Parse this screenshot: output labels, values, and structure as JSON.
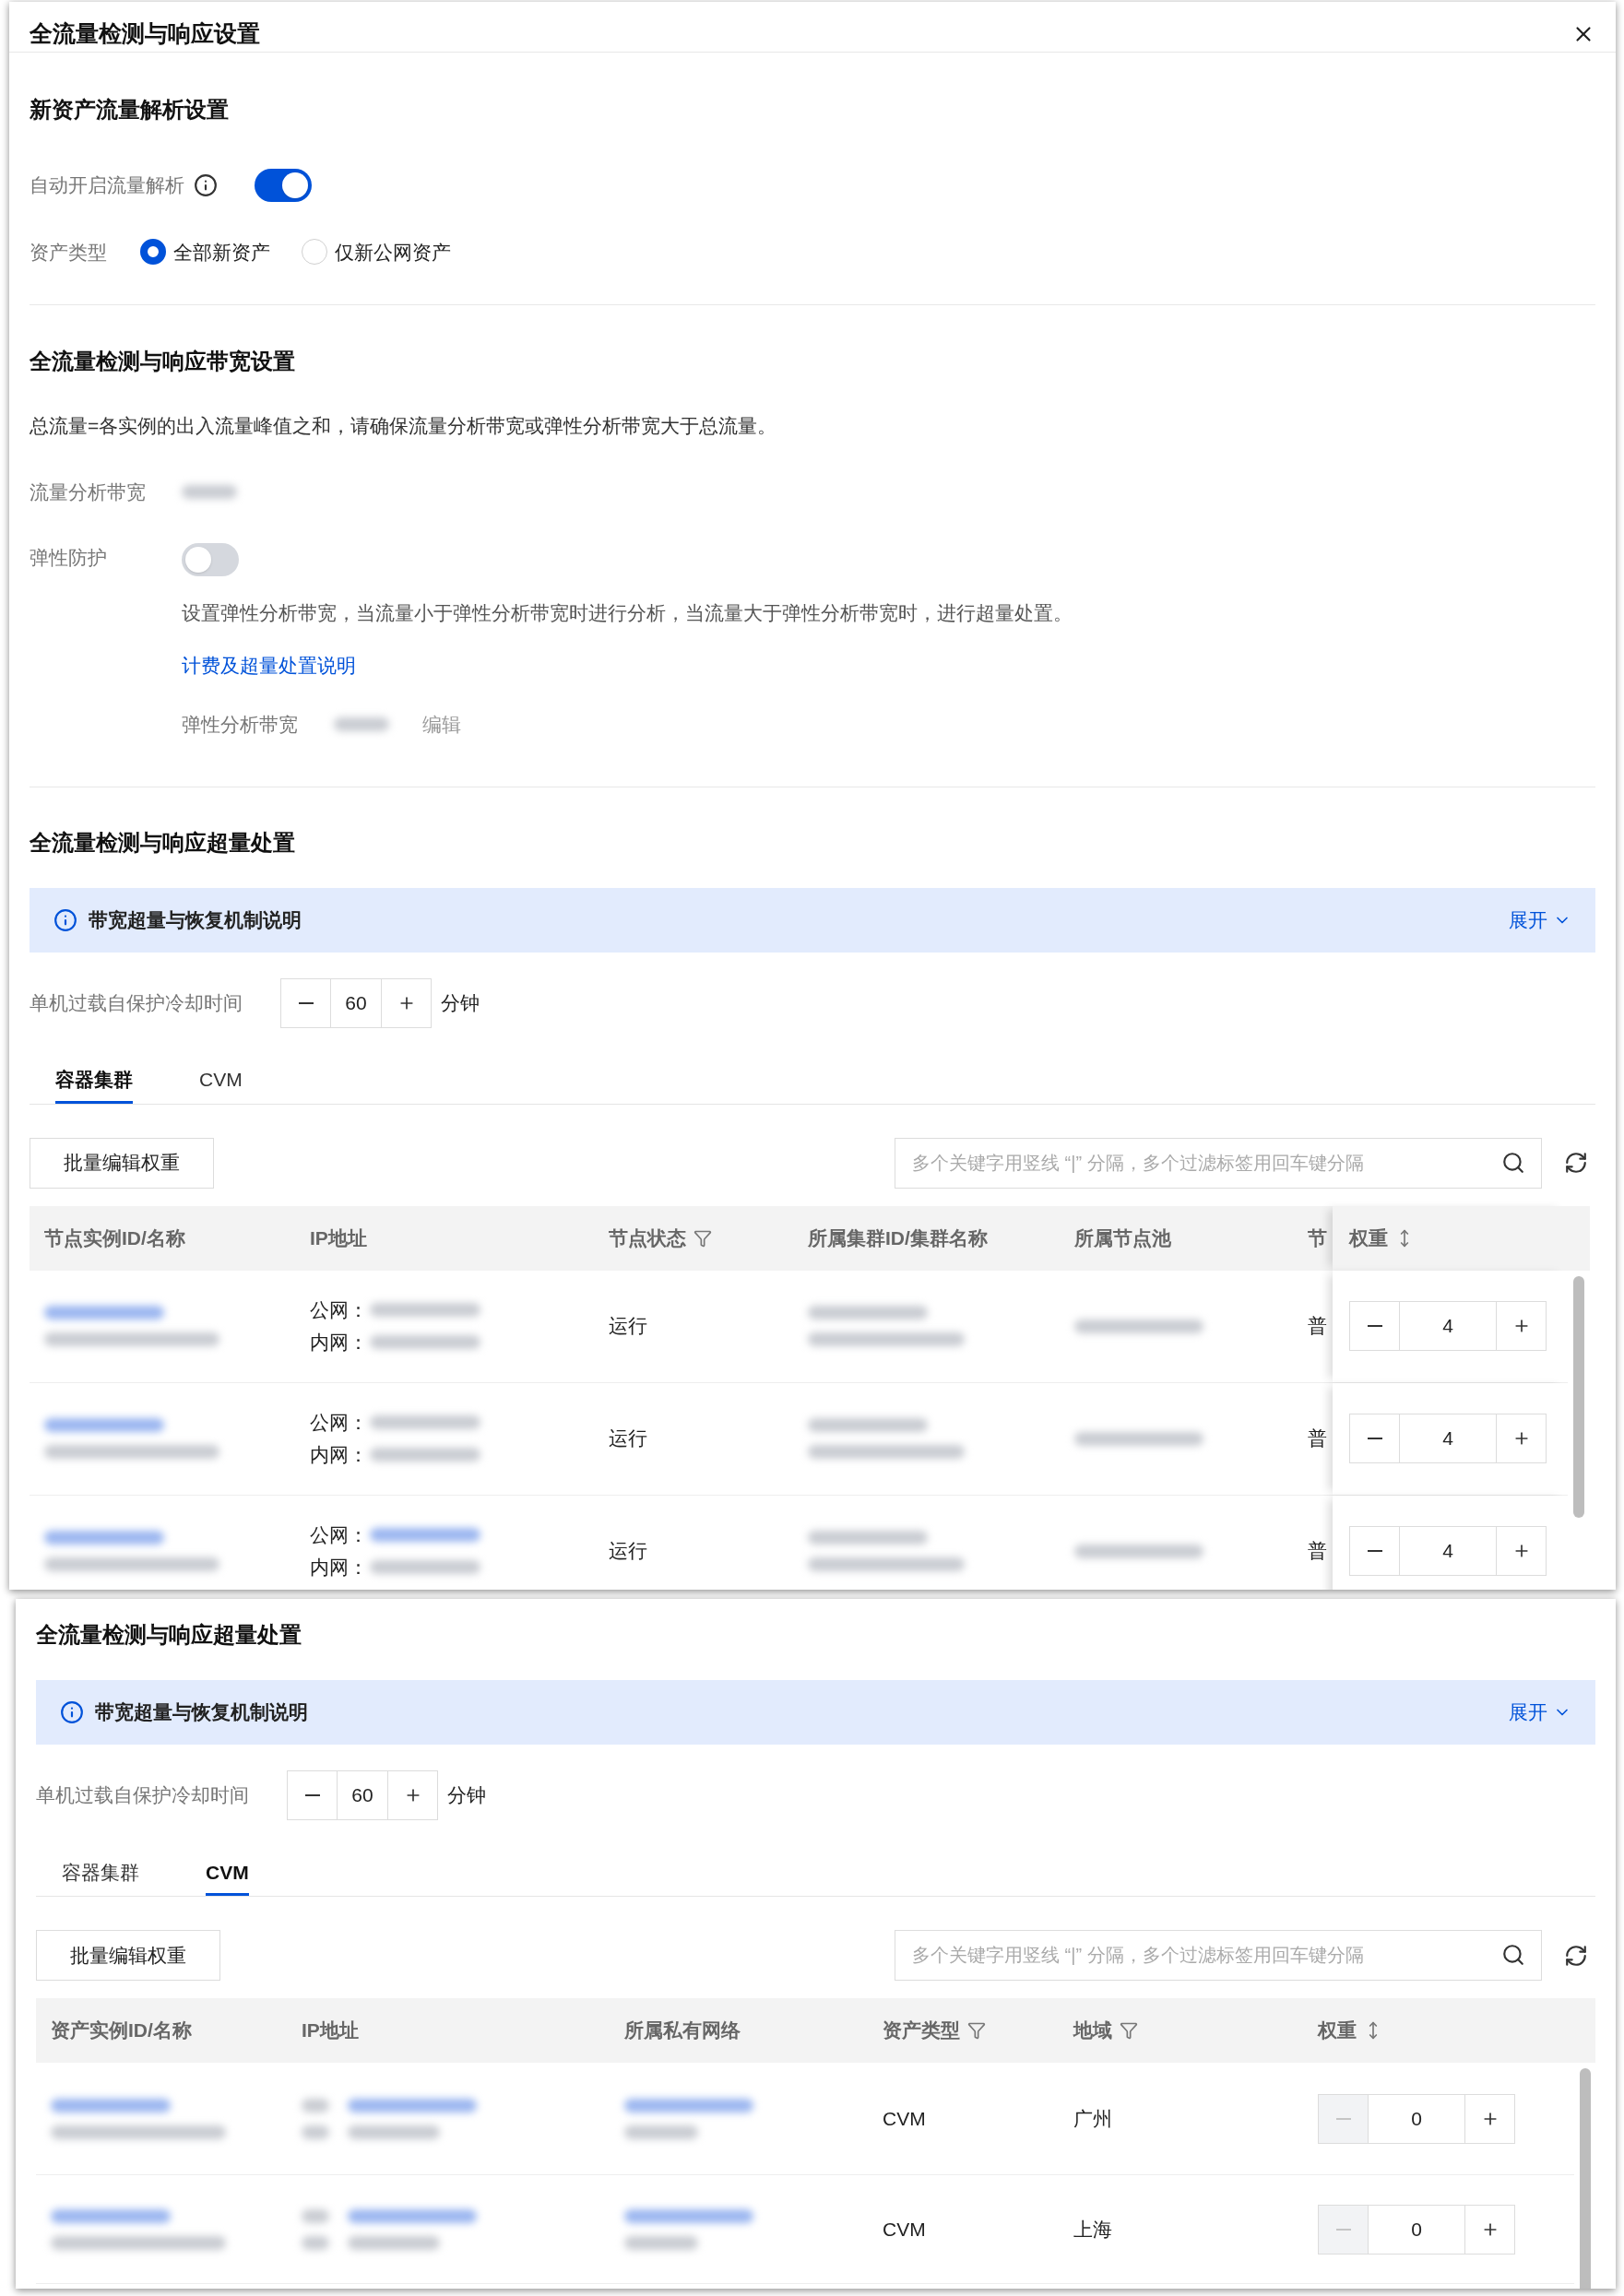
{
  "dialog": {
    "title": "全流量检测与响应设置"
  },
  "asset_section": {
    "title": "新资产流量解析设置",
    "auto_parse": {
      "label": "自动开启流量解析",
      "on": true
    },
    "asset_type": {
      "label": "资产类型",
      "options": [
        {
          "label": "全部新资产",
          "selected": true
        },
        {
          "label": "仅新公网资产",
          "selected": false
        }
      ]
    }
  },
  "bandwidth_section": {
    "title": "全流量检测与响应带宽设置",
    "note": "总流量=各实例的出入流量峰值之和，请确保流量分析带宽或弹性分析带宽大于总流量。",
    "analysis_label": "流量分析带宽",
    "elastic": {
      "label": "弹性防护",
      "on": false,
      "description": "设置弹性分析带宽，当流量小于弹性分析带宽时进行分析，当流量大于弹性分析带宽时，进行超量处置。",
      "link": "计费及超量处置说明",
      "bandwidth_label": "弹性分析带宽",
      "edit": "编辑"
    }
  },
  "overload_panels": [
    {
      "title": "全流量检测与响应超量处置",
      "banner": {
        "text": "带宽超量与恢复机制说明",
        "expand": "展开"
      },
      "cooldown": {
        "label": "单机过载自保护冷却时间",
        "value": "60",
        "unit": "分钟"
      },
      "tabs": [
        {
          "label": "容器集群",
          "selected": true
        },
        {
          "label": "CVM",
          "selected": false
        }
      ],
      "batch_button": "批量编辑权重",
      "search_placeholder": "多个关键字用竖线 “|” 分隔，多个过滤标签用回车键分隔",
      "columns": [
        {
          "label": "节点实例ID/名称",
          "kind": "id"
        },
        {
          "label": "IP地址",
          "kind": "ip"
        },
        {
          "label": "节点状态",
          "kind": "text",
          "filter": true
        },
        {
          "label": "所属集群ID/集群名称",
          "kind": "blur2"
        },
        {
          "label": "所属节点池",
          "kind": "blur1"
        },
        {
          "label": "节",
          "kind": "text"
        },
        {
          "label": "权重",
          "kind": "weight",
          "sort": true
        }
      ],
      "rows": [
        {
          "ip_labels": [
            "公网：",
            "内网："
          ],
          "values": [
            "运行",
            "普"
          ],
          "weight": "4",
          "minus_disabled": false
        },
        {
          "ip_labels": [
            "公网：",
            "内网："
          ],
          "values": [
            "运行",
            "普"
          ],
          "weight": "4",
          "minus_disabled": false
        },
        {
          "ip_labels": [
            "公网：",
            "内网："
          ],
          "values": [
            "运行",
            "普"
          ],
          "weight": "4",
          "minus_disabled": false
        }
      ]
    },
    {
      "title": "全流量检测与响应超量处置",
      "banner": {
        "text": "带宽超量与恢复机制说明",
        "expand": "展开"
      },
      "cooldown": {
        "label": "单机过载自保护冷却时间",
        "value": "60",
        "unit": "分钟"
      },
      "tabs": [
        {
          "label": "容器集群",
          "selected": false
        },
        {
          "label": "CVM",
          "selected": true
        }
      ],
      "batch_button": "批量编辑权重",
      "search_placeholder": "多个关键字用竖线 “|” 分隔，多个过滤标签用回车键分隔",
      "columns": [
        {
          "label": "资产实例ID/名称",
          "kind": "id"
        },
        {
          "label": "IP地址",
          "kind": "ipblur"
        },
        {
          "label": "所属私有网络",
          "kind": "vpc"
        },
        {
          "label": "资产类型",
          "kind": "text",
          "filter": true
        },
        {
          "label": "地域",
          "kind": "text",
          "filter": true
        },
        {
          "label": "权重",
          "kind": "weight",
          "sort": true
        }
      ],
      "rows": [
        {
          "values": [
            "CVM",
            "广州"
          ],
          "weight": "0",
          "minus_disabled": true
        },
        {
          "values": [
            "CVM",
            "上海"
          ],
          "weight": "0",
          "minus_disabled": true
        }
      ]
    }
  ]
}
